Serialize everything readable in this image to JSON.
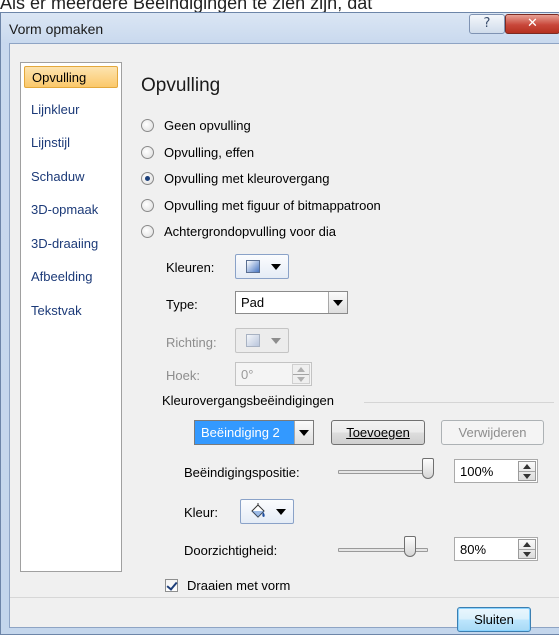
{
  "background_caption": "Als er meerdere Beëindigingen te zien zijn, dat",
  "window": {
    "title": "Vorm opmaken",
    "help_label": "?",
    "close_label": "✕"
  },
  "nav": {
    "items": [
      {
        "label": "Opvulling",
        "selected": true
      },
      {
        "label": "Lijnkleur"
      },
      {
        "label": "Lijnstijl"
      },
      {
        "label": "Schaduw"
      },
      {
        "label": "3D-opmaak"
      },
      {
        "label": "3D-draaiing"
      },
      {
        "label": "Afbeelding"
      },
      {
        "label": "Tekstvak"
      }
    ]
  },
  "pane": {
    "title": "Opvulling",
    "fill_options": [
      {
        "label": "Geen opvulling",
        "checked": false
      },
      {
        "label": "Opvulling, effen",
        "checked": false
      },
      {
        "label": "Opvulling met kleurovergang",
        "checked": true
      },
      {
        "label": "Opvulling met figuur of bitmappatroon",
        "checked": false
      },
      {
        "label": "Achtergrondopvulling voor dia",
        "checked": false
      }
    ],
    "colors_label": "Kleuren:",
    "type_label": "Type:",
    "type_value": "Pad",
    "direction_label": "Richting:",
    "angle_label": "Hoek:",
    "angle_value": "0°",
    "stops_group_label": "Kleurovergangsbeëindigingen",
    "stop_selected": "Beëindiging 2",
    "add_button": "Toevoegen",
    "remove_button": "Verwijderen",
    "position_label": "Beëindigingspositie:",
    "position_value": "100%",
    "position_level": 1.0,
    "color_label": "Kleur:",
    "transparency_label": "Doorzichtigheid:",
    "transparency_value": "80%",
    "transparency_level": 0.8,
    "rotate_label": "Draaien met vorm",
    "rotate_checked": true
  },
  "footer": {
    "close_button": "Sluiten"
  },
  "colors": {
    "title_gradient_top": "#dbe6f4",
    "selected_nav": "#fbc86a",
    "highlight": "#3399ff",
    "close_red": "#c8473a",
    "nav_text": "#1c3a78"
  }
}
